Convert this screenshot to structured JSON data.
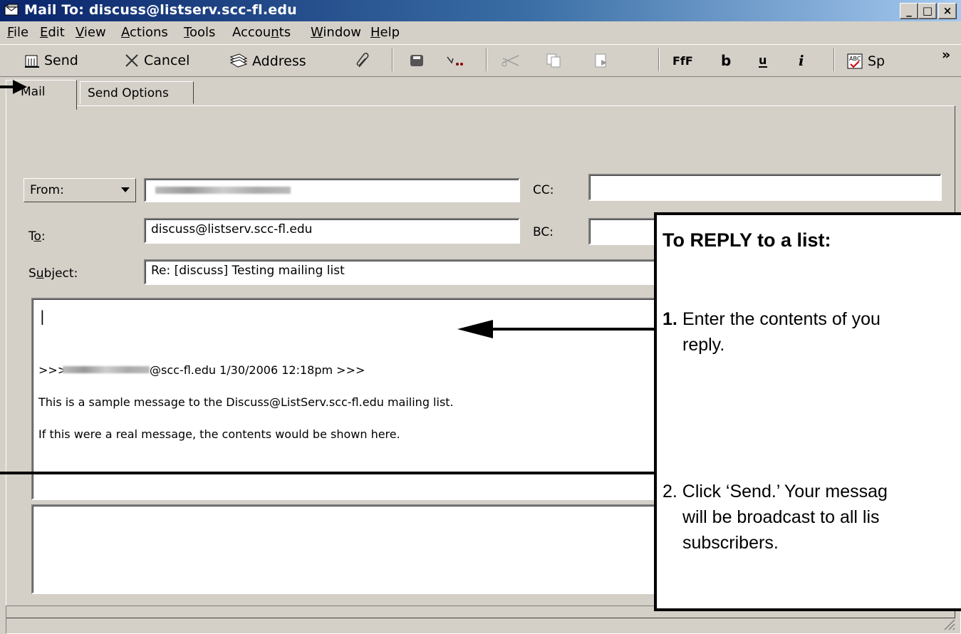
{
  "window": {
    "title": "Mail To: discuss@listserv.scc-fl.edu",
    "buttons": [
      "_",
      "□",
      "×"
    ]
  },
  "menu": {
    "file": "F",
    "file_rest": "ile",
    "edit": "E",
    "edit_rest": "dit",
    "view_pre": "V",
    "view_rest": "iew",
    "actions": "A",
    "actions_rest": "ctions",
    "tools": "T",
    "tools_rest": "ools",
    "accounts_pre": "Accou",
    "accounts_u": "n",
    "accounts_rest": "ts",
    "window": "W",
    "window_rest": "indow",
    "help": "H",
    "help_rest": "elp"
  },
  "toolbar": {
    "send": "Send",
    "cancel": "Cancel",
    "address": "Address",
    "spell": "Sp",
    "overflow": "»"
  },
  "tabs": {
    "mail": "Mail",
    "send_options": "Send Options"
  },
  "form": {
    "from_label": "From:",
    "cc_label": "CC:",
    "to_label_pre": "T",
    "to_label_u": "o",
    "to_label_rest": ":",
    "to_value": "discuss@listserv.scc-fl.edu",
    "bc_label": "BC:",
    "subject_label_pre": "S",
    "subject_label_u": "u",
    "subject_label_rest": "bject:",
    "subject_value": "Re: [discuss] Testing mailing list"
  },
  "message": {
    "cursor": "|",
    "header_prefix": ">>>",
    "header_suffix": "@scc-fl.edu 1/30/2006 12:18pm >>>",
    "line1": "This is a sample message to the Discuss@ListServ.scc-fl.edu mailing list.",
    "line2": "If this were a real message, the contents would be shown here."
  },
  "callout": {
    "heading": "To REPLY to a list:",
    "step1_num": "1.",
    "step1_line1": "Enter the contents of you",
    "step1_line2": "reply.",
    "step2_line1": "2.  Click ‘Send.’ Your messag",
    "step2_line2": "will be broadcast to all lis",
    "step2_line3": "subscribers."
  }
}
